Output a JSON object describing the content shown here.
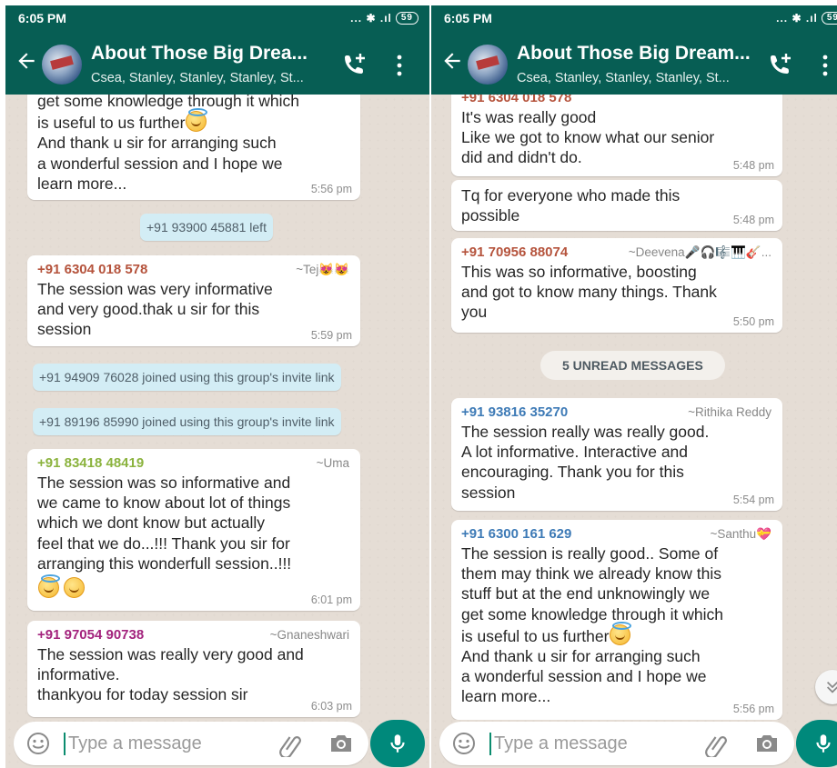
{
  "status": {
    "time": "6:05 PM",
    "icons": "... ✱ .ıl",
    "battery": "59"
  },
  "header": {
    "title": "About Those Big Drea...",
    "title_alt": "About Those Big Dream...",
    "subtitle": "Csea, Stanley, Stanley, Stanley, St..."
  },
  "composer": {
    "placeholder": "Type a message"
  },
  "left_chat": {
    "m1": {
      "body": "get some knowledge through it which\nis useful to us further",
      "body2": "And thank u sir for arranging such\na wonderful session and I hope we\nlearn more...",
      "time": "5:56 pm"
    },
    "sys1": "+91 93900 45881 left",
    "m2": {
      "sender": "+91 6304 018 578",
      "alias": "~Tej😻😻",
      "body": "The session  was very informative\nand very good.thak u sir for this\nsession",
      "time": "5:59 pm"
    },
    "sys2": "+91 94909 76028 joined using this group's invite link",
    "sys3": "+91 89196 85990 joined using this group's invite link",
    "m3": {
      "sender": "+91 83418 48419",
      "alias": "~Uma",
      "body": "The session was so informative and\nwe came to know about lot of things\nwhich we dont know but actually\nfeel that we do...!!! Thank you sir for\narranging this wonderfull session..!!!",
      "time": "6:01 pm"
    },
    "m4": {
      "sender": "+91 97054 90738",
      "alias": "~Gnaneshwari",
      "body": "The session was really very good and\ninformative.\nthankyou for today session sir",
      "time": "6:03 pm"
    }
  },
  "right_chat": {
    "m0": {
      "sender": "+91 6304 018 578"
    },
    "m1": {
      "body": "It's was really good\nLike we got to know what our senior\ndid and didn't do.",
      "time": "5:48 pm"
    },
    "m2": {
      "body": "Tq for everyone who made this\npossible",
      "time": "5:48 pm"
    },
    "m3": {
      "sender": "+91 70956 88074",
      "alias": "~Deevena🎤🎧🎼🎹🎸...",
      "body": "This was so informative, boosting\nand got to know many things. Thank\nyou",
      "time": "5:50 pm"
    },
    "unread": "5 UNREAD MESSAGES",
    "m4": {
      "sender": "+91 93816 35270",
      "alias": "~Rithika Reddy",
      "body": "The session really was really good.\nA lot informative. Interactive and\nencouraging. Thank you for this\nsession",
      "time": "5:54 pm"
    },
    "m5": {
      "sender": "+91 6300 161 629",
      "alias": "~Santhu💝",
      "body": "The session is really good.. Some of\nthem may think we already know this\nstuff but at the end unknowingly we\nget some knowledge through it which\nis useful to us further",
      "body2": "And thank u sir for arranging such\na wonderful session and I hope we\nlearn more...",
      "time": "5:56 pm"
    }
  },
  "colors": {
    "header": "#075e54",
    "accent": "#00897b",
    "sender_red": "#b5533c",
    "sender_green": "#8bb33e",
    "sender_magenta": "#a3237d",
    "sender_blue": "#3d7ab6"
  }
}
